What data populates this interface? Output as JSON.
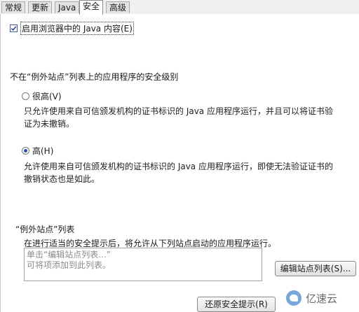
{
  "tabs": [
    {
      "label": "常规"
    },
    {
      "label": "更新"
    },
    {
      "label": "Java"
    },
    {
      "label": "安全"
    },
    {
      "label": "高级"
    }
  ],
  "enable_java": {
    "label": "启用浏览器中的 Java 内容(E)",
    "checked": true
  },
  "security_level": {
    "title": "不在“例外站点”列表上的应用程序的安全级别",
    "very_high": {
      "label": "很高(V)",
      "selected": false,
      "desc_line1": "只允许使用来自可信颁发机构的证书标识的 Java 应用程序运行，并且可以将证书验",
      "desc_line2": "证为未撤销。"
    },
    "high": {
      "label": "高(H)",
      "selected": true,
      "desc_line1": "允许使用来自可信颁发机构的证书标识的 Java 应用程序运行，即使无法验证证书的",
      "desc_line2": "撤销状态也是如此。"
    }
  },
  "exception_sites": {
    "title": "“例外站点”列表",
    "desc": "在进行适当的安全提示后，将允许从下列站点启动的应用程序运行。",
    "placeholder_line1": "单击“编辑站点列表...”",
    "placeholder_line2": "可将项添加到此列表。",
    "edit_button": "编辑站点列表(S)..."
  },
  "restore_button": "还原安全提示(R)",
  "watermark": {
    "text": "亿速云",
    "icon": "cloud-logo-icon"
  }
}
